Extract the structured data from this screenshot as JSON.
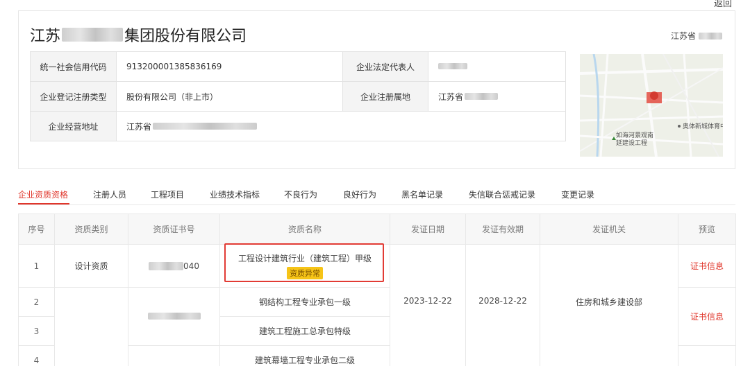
{
  "header": {
    "back_text": "返回",
    "company_name_prefix": "江苏",
    "company_name_suffix": "集团股份有限公司",
    "province_text": "江苏省"
  },
  "info": {
    "credit_code_label": "统一社会信用代码",
    "credit_code_value": "913200001385836169",
    "legal_rep_label": "企业法定代表人",
    "reg_type_label": "企业登记注册类型",
    "reg_type_value": "股份有限公司（非上市）",
    "reg_place_label": "企业注册属地",
    "reg_place_value": "江苏省",
    "address_label": "企业经营地址",
    "address_value": "江苏省"
  },
  "map": {
    "poi_1": "奥体新城体育中心",
    "poi_2": "如海河景观南",
    "poi_3": "延建设工程"
  },
  "tabs": [
    {
      "label": "企业资质资格",
      "active": true
    },
    {
      "label": "注册人员"
    },
    {
      "label": "工程项目"
    },
    {
      "label": "业绩技术指标"
    },
    {
      "label": "不良行为"
    },
    {
      "label": "良好行为"
    },
    {
      "label": "黑名单记录"
    },
    {
      "label": "失信联合惩戒记录"
    },
    {
      "label": "变更记录"
    }
  ],
  "table": {
    "headers": [
      "序号",
      "资质类别",
      "资质证书号",
      "资质名称",
      "发证日期",
      "发证有效期",
      "发证机关",
      "预览"
    ],
    "rows": [
      {
        "seq": "1",
        "category": "设计资质",
        "cert_no_suffix": "040",
        "name": "工程设计建筑行业（建筑工程）甲级",
        "badge": "资质异常"
      },
      {
        "seq": "2",
        "name": "钢结构工程专业承包一级"
      },
      {
        "seq": "3",
        "name": "建筑工程施工总承包特级"
      },
      {
        "seq": "4",
        "name": "建筑幕墙工程专业承包二级"
      }
    ],
    "issue_date": "2023-12-22",
    "valid_until": "2028-12-22",
    "authority": "住房和城乡建设部",
    "cert_link": "证书信息"
  }
}
